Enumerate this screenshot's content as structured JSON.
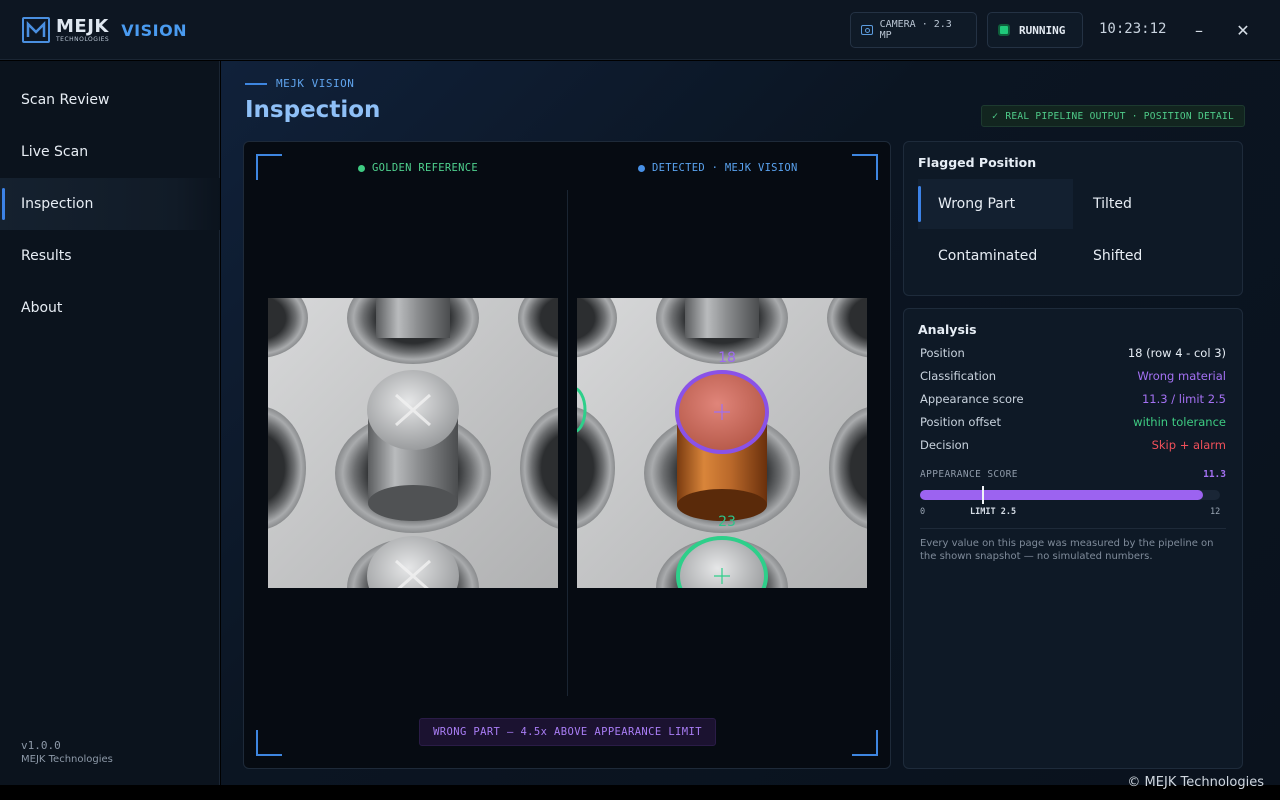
{
  "app": {
    "brand": "MEJK",
    "brand_sub": "TECHNOLOGIES",
    "product": "VISION"
  },
  "topbar": {
    "camera": "CAMERA · 2.3 MP",
    "status": "RUNNING",
    "clock": "10:23:12",
    "minimize": "–",
    "close": "✕"
  },
  "sidebar": {
    "items": [
      {
        "label": "Scan Review"
      },
      {
        "label": "Live Scan"
      },
      {
        "label": "Inspection",
        "active": true
      },
      {
        "label": "Results"
      },
      {
        "label": "About"
      }
    ],
    "version": "v1.0.0",
    "company": "MEJK Technologies"
  },
  "header": {
    "eyebrow": "MEJK VISION",
    "title": "Inspection",
    "badge": "REAL PIPELINE OUTPUT · POSITION DETAIL"
  },
  "viewer": {
    "golden_label": "GOLDEN REFERENCE",
    "detected_label": "DETECTED · MEJK VISION",
    "flag_position": "18",
    "neighbor_position": "23",
    "alert": "WRONG PART — 4.5x ABOVE APPEARANCE LIMIT"
  },
  "flagged": {
    "title": "Flagged Position",
    "options": [
      {
        "label": "Wrong Part",
        "selected": true
      },
      {
        "label": "Tilted"
      },
      {
        "label": "Contaminated"
      },
      {
        "label": "Shifted"
      }
    ]
  },
  "analysis": {
    "title": "Analysis",
    "rows": [
      {
        "key": "Position",
        "value": "18 (row 4 - col 3)",
        "color": "#e6edf5"
      },
      {
        "key": "Classification",
        "value": "Wrong material",
        "color": "#a471f3"
      },
      {
        "key": "Appearance score",
        "value": "11.3 / limit 2.5",
        "color": "#a471f3"
      },
      {
        "key": "Position offset",
        "value": "within tolerance",
        "color": "#3ecb82"
      },
      {
        "key": "Decision",
        "value": "Skip + alarm",
        "color": "#f0505a"
      }
    ],
    "score_label": "APPEARANCE SCORE",
    "score_value": "11.3",
    "score": 11.3,
    "limit": 2.5,
    "scale_min": "0",
    "scale_max": "12",
    "scale_min_num": 0,
    "scale_max_num": 12,
    "limit_label": "LIMIT 2.5",
    "note": "Every value on this page was measured by the pipeline on the shown snapshot — no simulated numbers."
  },
  "footer": {
    "copyright": "© MEJK Technologies"
  }
}
